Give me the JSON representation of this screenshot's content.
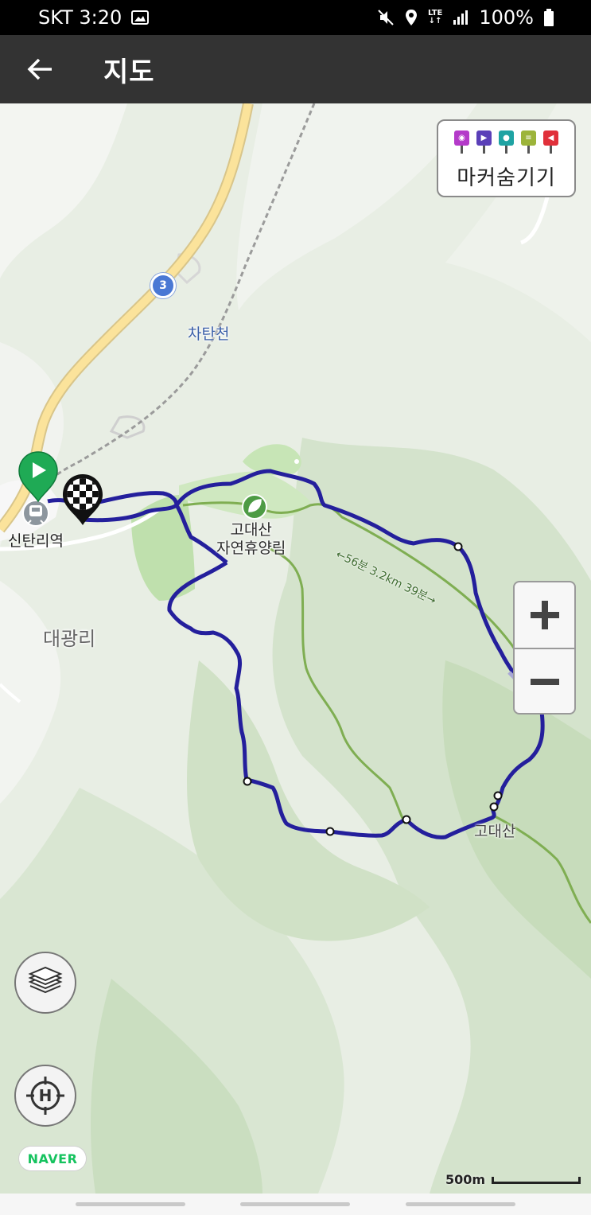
{
  "status_bar": {
    "carrier_time": "SKT 3:20",
    "network": "LTE",
    "battery": "100%",
    "icons": [
      "image-icon",
      "mute-icon",
      "location-icon",
      "lte-icon",
      "signal-icon",
      "battery-icon"
    ]
  },
  "app_bar": {
    "title": "지도",
    "back_icon": "arrow-left-icon"
  },
  "marker_panel": {
    "label": "마커숨기기",
    "icons": [
      {
        "name": "camera-marker-icon",
        "color": "#b43ac9"
      },
      {
        "name": "video-marker-icon",
        "color": "#5a3fb8"
      },
      {
        "name": "voice-marker-icon",
        "color": "#1ea3a3"
      },
      {
        "name": "memo-marker-icon",
        "color": "#9cb43a"
      },
      {
        "name": "alert-marker-icon",
        "color": "#e0303a"
      }
    ]
  },
  "map": {
    "labels": {
      "station": "신탄리역",
      "village": "대광리",
      "stream": "차탄천",
      "forest_line1": "고대산",
      "forest_line2": "자연휴양림",
      "peak": "고대산",
      "route_info": "←56분 3.2km 39분→"
    },
    "road_number": "3",
    "colors": {
      "track": "#241f9c",
      "trail": "#7fae52",
      "start_marker": "#1faa55",
      "park": "#cde6bf"
    }
  },
  "zoom": {
    "in_icon": "plus-icon",
    "out_icon": "minus-icon"
  },
  "buttons": {
    "layers_icon": "layers-icon",
    "locate_icon": "home-location-icon"
  },
  "brand": "NAVER",
  "scale": "500m"
}
